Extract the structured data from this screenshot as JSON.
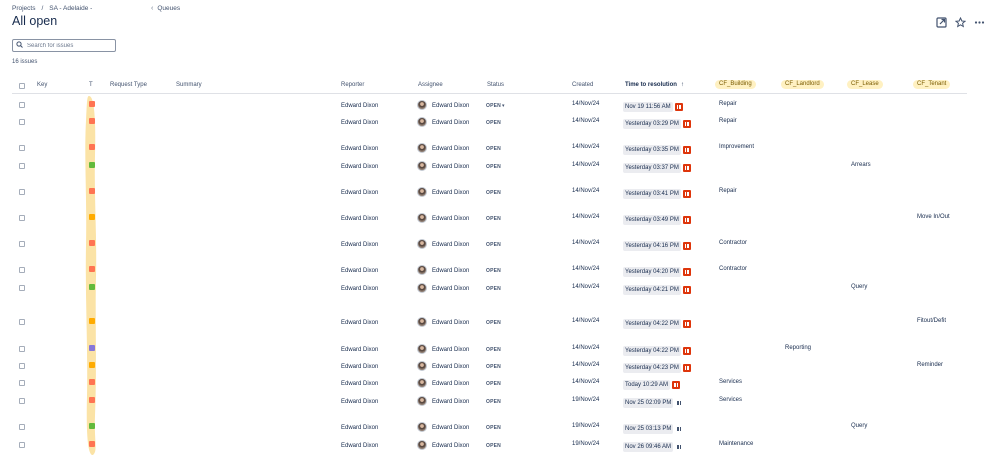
{
  "breadcrumbs": [
    "Projects",
    "/",
    "SA - Adelaide -"
  ],
  "queues_label": "Queues",
  "title": "All open",
  "search": {
    "placeholder": "Search for issues"
  },
  "issue_count": "16 issues",
  "columns": {
    "key": "Key",
    "type": "T",
    "request_type": "Request Type",
    "summary": "Summary",
    "reporter": "Reporter",
    "assignee": "Assignee",
    "status": "Status",
    "created": "Created",
    "time_to_resolution": "Time to resolution",
    "sort_indicator": "↑",
    "cf_building": "CF_Building",
    "cf_landlord": "CF_Landlord",
    "cf_lease": "CF_Lease",
    "cf_tenant": "CF_Tenant"
  },
  "colors": {
    "paused_breached": "#de350b",
    "cf_highlight": "#fff1c2",
    "type_blob": "#fbe3a6"
  },
  "header_icons": [
    "open-in-new-icon",
    "star-icon",
    "more-icon"
  ],
  "rows": [
    {
      "type_color": "#ff7452",
      "reporter": "Edward Dixon",
      "assignee": "Edward Dixon",
      "status": "OPEN",
      "status_dropdown": true,
      "created": "14/Nov/24",
      "time": "Nov 19 11:56 AM",
      "breached": true,
      "cf_building": "Repair",
      "cf_landlord": "",
      "cf_lease": "",
      "cf_tenant": ""
    },
    {
      "type_color": "#ff7452",
      "reporter": "Edward Dixon",
      "assignee": "Edward Dixon",
      "status": "OPEN",
      "status_dropdown": false,
      "created": "14/Nov/24",
      "time": "Yesterday 03:29 PM",
      "breached": true,
      "cf_building": "Repair",
      "cf_landlord": "",
      "cf_lease": "",
      "cf_tenant": ""
    },
    {
      "type_color": "#ff7452",
      "reporter": "Edward Dixon",
      "assignee": "Edward Dixon",
      "status": "OPEN",
      "status_dropdown": false,
      "created": "14/Nov/24",
      "time": "Yesterday 03:35 PM",
      "breached": true,
      "cf_building": "Improvement",
      "cf_landlord": "",
      "cf_lease": "",
      "cf_tenant": ""
    },
    {
      "type_color": "#63ba3c",
      "reporter": "Edward Dixon",
      "assignee": "Edward Dixon",
      "status": "OPEN",
      "status_dropdown": false,
      "created": "14/Nov/24",
      "time": "Yesterday 03:37 PM",
      "breached": true,
      "cf_building": "",
      "cf_landlord": "",
      "cf_lease": "Arrears",
      "cf_tenant": ""
    },
    {
      "type_color": "#ff7452",
      "reporter": "Edward Dixon",
      "assignee": "Edward Dixon",
      "status": "OPEN",
      "status_dropdown": false,
      "created": "14/Nov/24",
      "time": "Yesterday 03:41 PM",
      "breached": true,
      "cf_building": "Repair",
      "cf_landlord": "",
      "cf_lease": "",
      "cf_tenant": ""
    },
    {
      "type_color": "#ffab00",
      "reporter": "Edward Dixon",
      "assignee": "Edward Dixon",
      "status": "OPEN",
      "status_dropdown": false,
      "created": "14/Nov/24",
      "time": "Yesterday 03:49 PM",
      "breached": true,
      "cf_building": "",
      "cf_landlord": "",
      "cf_lease": "",
      "cf_tenant": "Move In/Out"
    },
    {
      "type_color": "#ff7452",
      "reporter": "Edward Dixon",
      "assignee": "Edward Dixon",
      "status": "OPEN",
      "status_dropdown": false,
      "created": "14/Nov/24",
      "time": "Yesterday 04:16 PM",
      "breached": true,
      "cf_building": "Contractor",
      "cf_landlord": "",
      "cf_lease": "",
      "cf_tenant": ""
    },
    {
      "type_color": "#ff7452",
      "reporter": "Edward Dixon",
      "assignee": "Edward Dixon",
      "status": "OPEN",
      "status_dropdown": false,
      "created": "14/Nov/24",
      "time": "Yesterday 04:20 PM",
      "breached": true,
      "cf_building": "Contractor",
      "cf_landlord": "",
      "cf_lease": "",
      "cf_tenant": ""
    },
    {
      "type_color": "#63ba3c",
      "reporter": "Edward Dixon",
      "assignee": "Edward Dixon",
      "status": "OPEN",
      "status_dropdown": false,
      "created": "14/Nov/24",
      "time": "Yesterday 04:21 PM",
      "breached": true,
      "cf_building": "",
      "cf_landlord": "",
      "cf_lease": "Query",
      "cf_tenant": ""
    },
    {
      "type_color": "#ffab00",
      "reporter": "Edward Dixon",
      "assignee": "Edward Dixon",
      "status": "OPEN",
      "status_dropdown": false,
      "created": "14/Nov/24",
      "time": "Yesterday 04:22 PM",
      "breached": true,
      "cf_building": "",
      "cf_landlord": "",
      "cf_lease": "",
      "cf_tenant": "Fitout/Defit"
    },
    {
      "type_color": "#8777d9",
      "reporter": "Edward Dixon",
      "assignee": "Edward Dixon",
      "status": "OPEN",
      "status_dropdown": false,
      "created": "14/Nov/24",
      "time": "Yesterday 04:22 PM",
      "breached": true,
      "cf_building": "",
      "cf_landlord": "Reporting",
      "cf_lease": "",
      "cf_tenant": ""
    },
    {
      "type_color": "#ffab00",
      "reporter": "Edward Dixon",
      "assignee": "Edward Dixon",
      "status": "OPEN",
      "status_dropdown": false,
      "created": "14/Nov/24",
      "time": "Yesterday 04:23 PM",
      "breached": true,
      "cf_building": "",
      "cf_landlord": "",
      "cf_lease": "",
      "cf_tenant": "Reminder"
    },
    {
      "type_color": "#ff7452",
      "reporter": "Edward Dixon",
      "assignee": "Edward Dixon",
      "status": "OPEN",
      "status_dropdown": false,
      "created": "14/Nov/24",
      "time": "Today 10:29 AM",
      "breached": true,
      "cf_building": "Services",
      "cf_landlord": "",
      "cf_lease": "",
      "cf_tenant": ""
    },
    {
      "type_color": "#ff7452",
      "reporter": "Edward Dixon",
      "assignee": "Edward Dixon",
      "status": "OPEN",
      "status_dropdown": false,
      "created": "19/Nov/24",
      "time": "Nov 25 02:09 PM",
      "breached": false,
      "cf_building": "Services",
      "cf_landlord": "",
      "cf_lease": "",
      "cf_tenant": ""
    },
    {
      "type_color": "#63ba3c",
      "reporter": "Edward Dixon",
      "assignee": "Edward Dixon",
      "status": "OPEN",
      "status_dropdown": false,
      "created": "19/Nov/24",
      "time": "Nov 25 03:13 PM",
      "breached": false,
      "cf_building": "",
      "cf_landlord": "",
      "cf_lease": "Query",
      "cf_tenant": ""
    },
    {
      "type_color": "#ff7452",
      "reporter": "Edward Dixon",
      "assignee": "Edward Dixon",
      "status": "OPEN",
      "status_dropdown": false,
      "created": "19/Nov/24",
      "time": "Nov 26 09:46 AM",
      "breached": false,
      "cf_building": "Maintenance",
      "cf_landlord": "",
      "cf_lease": "",
      "cf_tenant": ""
    }
  ]
}
